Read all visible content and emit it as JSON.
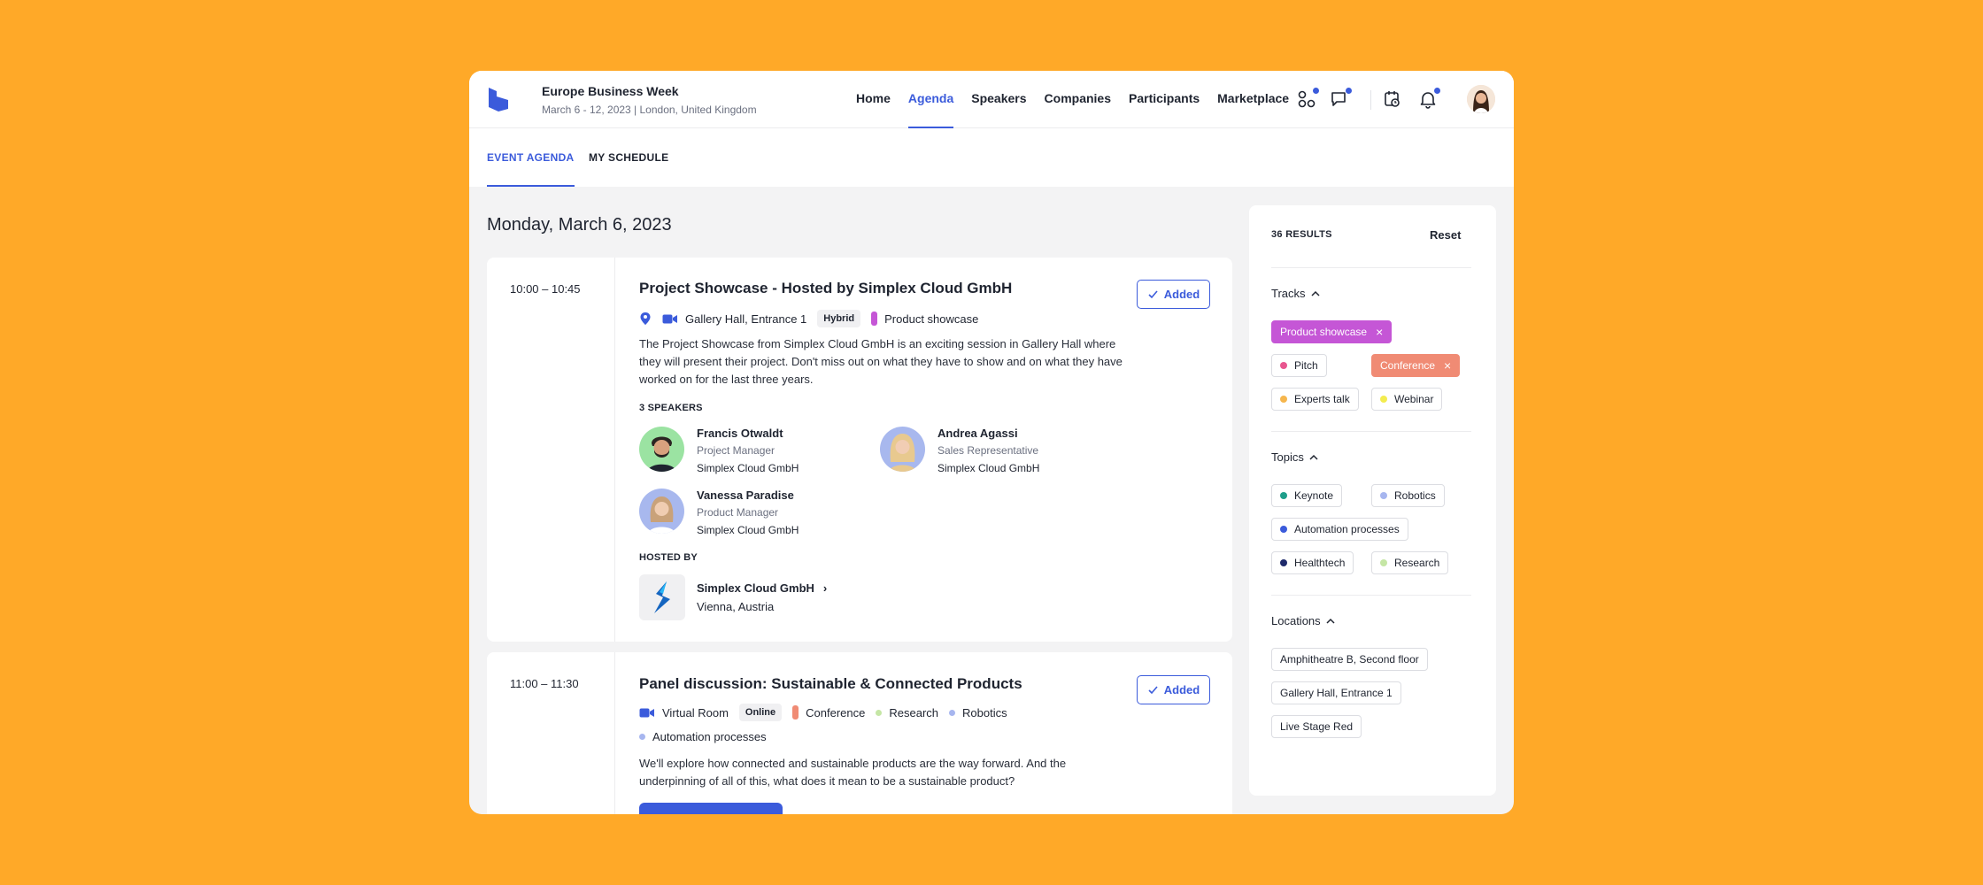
{
  "event": {
    "name": "Europe Business Week",
    "subtitle": "March 6 - 12, 2023 | London, United Kingdom"
  },
  "nav": [
    "Home",
    "Agenda",
    "Speakers",
    "Companies",
    "Participants",
    "Marketplace"
  ],
  "nav_active": "Agenda",
  "subtabs": {
    "event_agenda": "EVENT AGENDA",
    "my_schedule": "MY SCHEDULE"
  },
  "date_heading": "Monday, March 6, 2023",
  "sessions": [
    {
      "time": "10:00 – 10:45",
      "title": "Project Showcase - Hosted by Simplex Cloud GmbH",
      "location": "Gallery Hall, Entrance 1",
      "format": "Hybrid",
      "track": "Product showcase",
      "description": "The Project Showcase from Simplex Cloud GmbH is an exciting session in Gallery Hall where they will present their project. Don't miss out on what they have to show and on what they have worked on for the last three years.",
      "speakers_label": "3 SPEAKERS",
      "speakers": [
        {
          "name": "Francis Otwaldt",
          "role": "Project Manager",
          "company": "Simplex Cloud GmbH"
        },
        {
          "name": "Andrea Agassi",
          "role": "Sales Representative",
          "company": "Simplex Cloud GmbH"
        },
        {
          "name": "Vanessa Paradise",
          "role": "Product Manager",
          "company": "Simplex Cloud GmbH"
        }
      ],
      "hosted_label": "HOSTED BY",
      "host": {
        "name": "Simplex Cloud GmbH",
        "location": "Vienna, Austria"
      },
      "added_label": "Added"
    },
    {
      "time": "11:00 – 11:30",
      "title": "Panel discussion: Sustainable & Connected Products",
      "location": "Virtual Room",
      "format": "Online",
      "tags": [
        "Conference",
        "Research",
        "Robotics",
        "Automation processes"
      ],
      "description": "We'll explore how connected and sustainable products are the way forward. And the underpinning of all of this, what does it mean to be a sustainable product?",
      "added_label": "Added"
    }
  ],
  "filters": {
    "results": "36 RESULTS",
    "reset": "Reset",
    "tracks_label": "Tracks",
    "tracks": [
      {
        "label": "Product showcase",
        "color": "#c556d6",
        "selected": true
      },
      {
        "label": "Pitch",
        "color": "#e8568f",
        "selected": false
      },
      {
        "label": "Conference",
        "color": "#f08b74",
        "selected": true
      },
      {
        "label": "Experts talk",
        "color": "#f6b64d",
        "selected": false
      },
      {
        "label": "Webinar",
        "color": "#f3ec4f",
        "selected": false
      }
    ],
    "topics_label": "Topics",
    "topics": [
      {
        "label": "Keynote",
        "color": "#1e9e8a"
      },
      {
        "label": "Robotics",
        "color": "#a7b6ef"
      },
      {
        "label": "Automation processes",
        "color": "#3b5bdb"
      },
      {
        "label": "Healthtech",
        "color": "#1f2a6b"
      },
      {
        "label": "Research",
        "color": "#c5e6a5"
      }
    ],
    "locations_label": "Locations",
    "locations": [
      "Amphitheatre B, Second floor",
      "Gallery Hall, Entrance 1",
      "Live Stage Red"
    ]
  },
  "colors": {
    "accent": "#3b5bdb",
    "background": "#FFA928"
  }
}
